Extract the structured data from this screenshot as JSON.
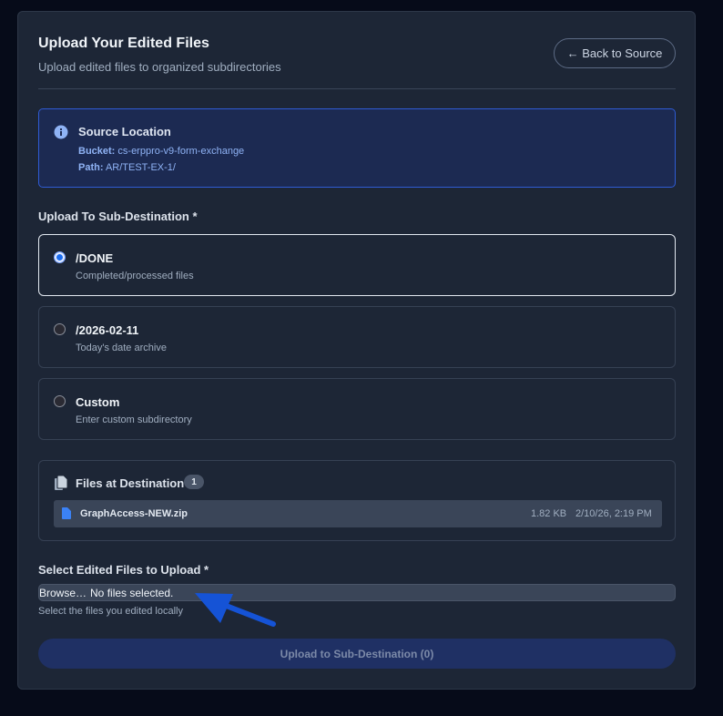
{
  "header": {
    "title": "Upload Your Edited Files",
    "subtitle": "Upload edited files to organized subdirectories",
    "back_label": "← Back to Source"
  },
  "source": {
    "title": "Source Location",
    "bucket_label": "Bucket:",
    "bucket_value": "cs-erppro-v9-form-exchange",
    "path_label": "Path:",
    "path_value": "AR/TEST-EX-1/"
  },
  "destination": {
    "label": "Upload To Sub-Destination *",
    "options": [
      {
        "name": "/DONE",
        "description": "Completed/processed files",
        "selected": true
      },
      {
        "name": "/2026-02-11",
        "description": "Today's date archive",
        "selected": false
      },
      {
        "name": "Custom",
        "description": "Enter custom subdirectory",
        "selected": false
      }
    ]
  },
  "files_at_destination": {
    "title": "Files at Destination",
    "count": "1",
    "files": [
      {
        "name": "GraphAccess-NEW.zip",
        "size": "1.82 KB",
        "date": "2/10/26, 2:19 PM"
      }
    ]
  },
  "file_select": {
    "label": "Select Edited Files to Upload *",
    "browse_label": "Browse…",
    "status": "No files selected.",
    "hint": "Select the files you edited locally"
  },
  "upload_button": "Upload to Sub-Destination (0)",
  "colors": {
    "accent": "#1a6cf0",
    "annotation_arrow": "#1553d6",
    "card_bg": "#1d2636",
    "page_bg": "#060b19"
  },
  "icons": [
    "info-icon",
    "files-icon",
    "file-icon",
    "annotation-arrow"
  ]
}
